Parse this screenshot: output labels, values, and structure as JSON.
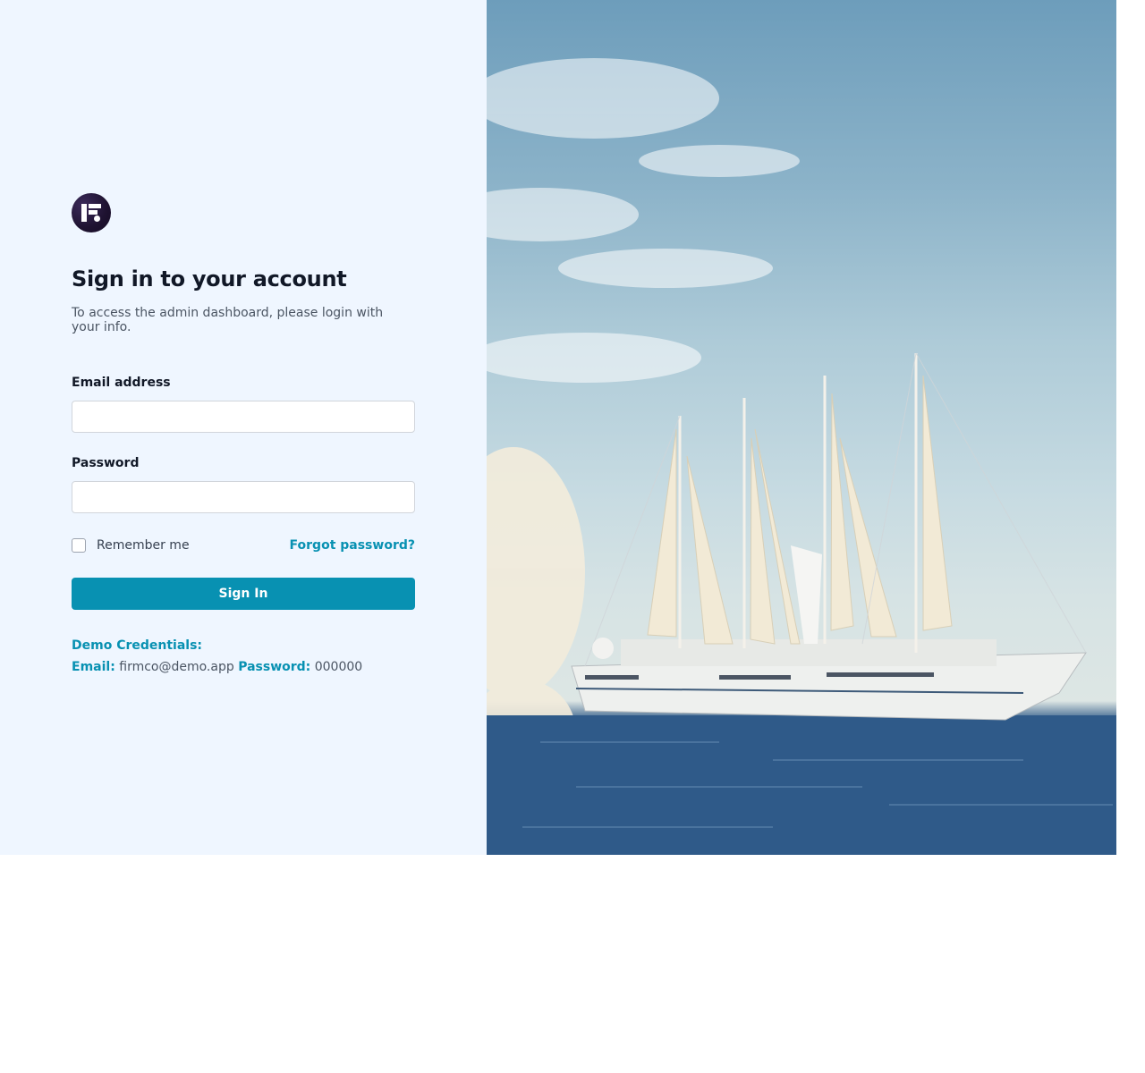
{
  "brand": {
    "logo_icon": "firmco-logo-icon"
  },
  "header": {
    "title": "Sign in to your account",
    "subtitle": "To access the admin dashboard, please login with your info."
  },
  "form": {
    "email_label": "Email address",
    "email_value": "",
    "password_label": "Password",
    "password_value": "",
    "remember_label": "Remember me",
    "remember_checked": false,
    "forgot_label": "Forgot password?",
    "submit_label": "Sign In"
  },
  "demo": {
    "title": "Demo Credentials:",
    "email_key": "Email:",
    "email_value": "firmco@demo.app",
    "password_key": "Password:",
    "password_value": "000000"
  },
  "hero_image": {
    "subject": "sailing cruise ship on the sea",
    "icon": "hero-photo-image"
  },
  "colors": {
    "accent": "#0891b2",
    "panel_bg": "#eff6ff",
    "title": "#111827",
    "muted": "#4b5563"
  }
}
